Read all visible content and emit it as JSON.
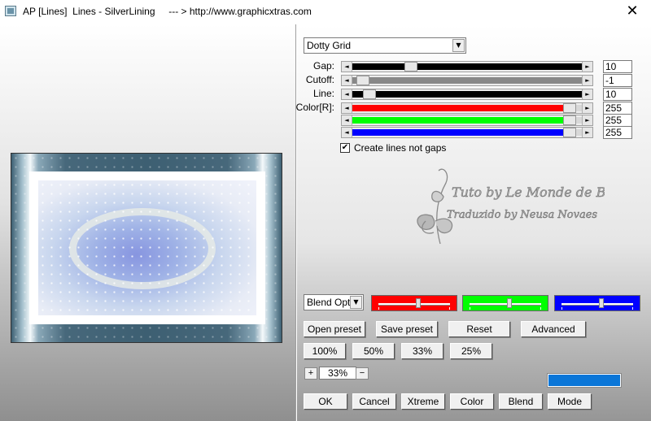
{
  "window": {
    "title": "AP [Lines]  Lines - SilverLining     --- > http://www.graphicxtras.com",
    "close_glyph": "✕"
  },
  "style_select": {
    "value": "Dotty Grid"
  },
  "sliders": [
    {
      "label": "Gap:",
      "value": "10",
      "fill": "#000000",
      "position": 0.24
    },
    {
      "label": "Cutoff:",
      "value": "-1",
      "fill": "#888888",
      "position": 0.02
    },
    {
      "label": "Line:",
      "value": "10",
      "fill": "#000000",
      "position": 0.05
    },
    {
      "label": "Color[R]:",
      "value": "255",
      "fill": "#ff0000",
      "position": 1.0
    },
    {
      "label": "",
      "value": "255",
      "fill": "#00ff00",
      "position": 1.0
    },
    {
      "label": "",
      "value": "255",
      "fill": "#0000ff",
      "position": 1.0
    }
  ],
  "checkbox": {
    "label": "Create lines not gaps",
    "checked": true,
    "mark": "✔"
  },
  "watermark": {
    "line1": "Tuto by Le Monde de Bea",
    "line2": "Traduzido by Neusa Novaes"
  },
  "blend_select": {
    "value": "Blend Options"
  },
  "color_boxes": [
    {
      "color": "#ff0000",
      "position": 0.55
    },
    {
      "color": "#00ff00",
      "position": 0.55
    },
    {
      "color": "#0000ff",
      "position": 0.55
    }
  ],
  "buttons": {
    "open_preset": "Open preset",
    "save_preset": "Save preset",
    "reset": "Reset",
    "advanced": "Advanced",
    "zoom_100": "100%",
    "zoom_50": "50%",
    "zoom_33": "33%",
    "zoom_25": "25%",
    "ok": "OK",
    "cancel": "Cancel",
    "xtreme": "Xtreme",
    "color": "Color",
    "blend": "Blend",
    "mode": "Mode"
  },
  "zoom": {
    "plus": "+",
    "minus": "−",
    "value": "33%"
  },
  "arrows": {
    "left": "◄",
    "right": "►",
    "down": "▼"
  },
  "colors": {
    "accent_bar": "#0a76d8"
  }
}
